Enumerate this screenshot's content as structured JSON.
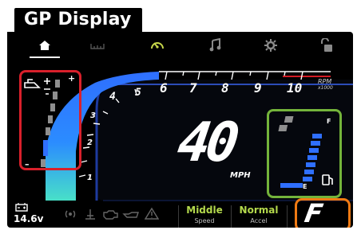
{
  "title": "GP Display",
  "nav": {
    "items": [
      {
        "icon": "home-icon",
        "active": true
      },
      {
        "icon": "trip-icon",
        "active": false
      },
      {
        "icon": "gauge-icon",
        "active": false
      },
      {
        "icon": "music-icon",
        "active": false
      },
      {
        "icon": "settings-icon",
        "active": false
      },
      {
        "icon": "unlock-icon",
        "active": false
      }
    ]
  },
  "rpm": {
    "labels": [
      "1",
      "2",
      "3",
      "4",
      "5",
      "6",
      "7",
      "8",
      "9",
      "10"
    ],
    "unit_top": "RPM",
    "unit_bottom": "x1000"
  },
  "speed": {
    "value": "40",
    "unit": "MPH"
  },
  "fuel": {
    "full_label": "F",
    "empty_label": "E"
  },
  "status": {
    "battery_voltage": "14.6v"
  },
  "modes": [
    {
      "value": "Middle",
      "label": "Speed"
    },
    {
      "value": "Normal",
      "label": "Accel"
    }
  ],
  "gear": "F",
  "colors": {
    "accent_blue": "#2f6fff",
    "mode_green": "#b4d94c",
    "trim_highlight": "#d9202b",
    "fuel_highlight": "#74b43b",
    "gear_highlight": "#f07a13"
  }
}
